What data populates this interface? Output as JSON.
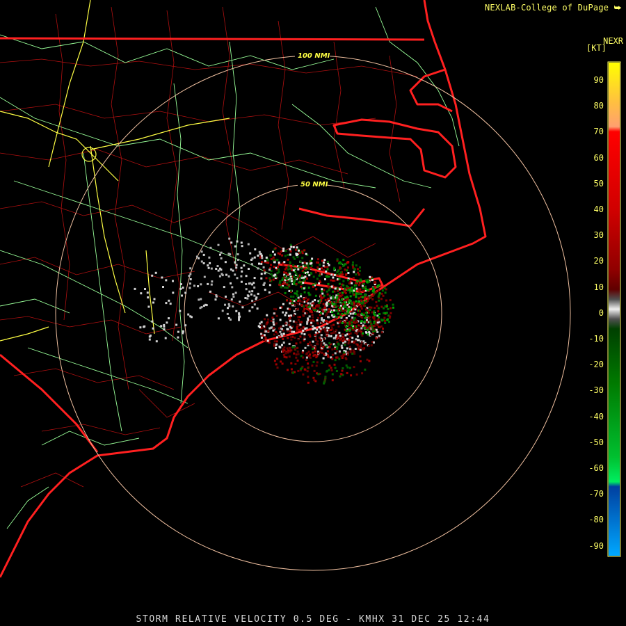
{
  "header": {
    "credit": "NEXLAB-College of DuPage",
    "credit_logo": "cod-logo-icon",
    "product": "NEXR",
    "unit": "[KT]"
  },
  "map": {
    "radar_site": "KMHX",
    "range_rings": [
      {
        "label": "50 NMI"
      },
      {
        "label": "100 NMI"
      }
    ],
    "colors": {
      "background": "#000000",
      "state_borders": "#ff2020",
      "county_lines": "#b01010",
      "highways": "#99ff99",
      "interstates": "#ffff44",
      "range_rings": "#f0c0a0",
      "ring_labels": "#ffff44"
    }
  },
  "legend": {
    "ticks": [
      "90",
      "80",
      "70",
      "60",
      "50",
      "40",
      "30",
      "20",
      "10",
      "0",
      "-10",
      "-20",
      "-30",
      "-40",
      "-50",
      "-60",
      "-70",
      "-80",
      "-90"
    ],
    "color_stops": [
      "#ffff00",
      "#ffb060",
      "#ff0000",
      "#d00000",
      "#a00000",
      "#700000",
      "#404040",
      "#f0f0f0",
      "#404040",
      "#006000",
      "#00a000",
      "#00e050",
      "#0050c0",
      "#00a0ff"
    ]
  },
  "footer": {
    "caption": "STORM RELATIVE VELOCITY 0.5 DEG - KMHX 31 DEC 25 12:44"
  }
}
